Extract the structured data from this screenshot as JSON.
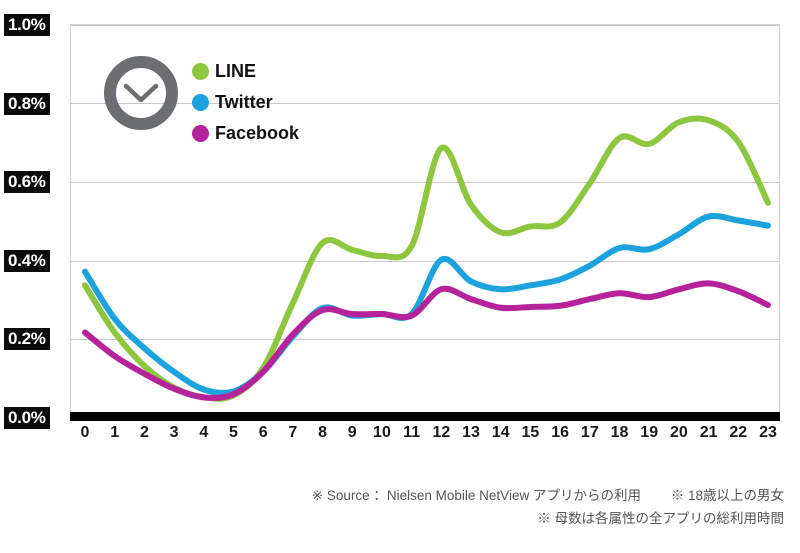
{
  "chart_data": {
    "type": "line",
    "title": "",
    "subtitle": "",
    "xlabel": "",
    "ylabel": "",
    "x": [
      0,
      1,
      2,
      3,
      4,
      5,
      6,
      7,
      8,
      9,
      10,
      11,
      12,
      13,
      14,
      15,
      16,
      17,
      18,
      19,
      20,
      21,
      22,
      23
    ],
    "xtick_labels": [
      "0",
      "1",
      "2",
      "3",
      "4",
      "5",
      "6",
      "7",
      "8",
      "9",
      "10",
      "11",
      "12",
      "13",
      "14",
      "15",
      "16",
      "17",
      "18",
      "19",
      "20",
      "21",
      "22",
      "23"
    ],
    "ytick_labels": [
      "0.0%",
      "0.2%",
      "0.4%",
      "0.6%",
      "0.8%",
      "1.0%"
    ],
    "ytick_values": [
      0.0,
      0.2,
      0.4,
      0.6,
      0.8,
      1.0
    ],
    "ylim": [
      0.0,
      1.0
    ],
    "xlim": [
      0,
      23
    ],
    "grid": true,
    "legend_position": "top-left-inside",
    "value_unit": "%",
    "series": [
      {
        "name": "LINE",
        "color": "#8DC63F",
        "values": [
          0.335,
          0.215,
          0.13,
          0.075,
          0.05,
          0.055,
          0.125,
          0.29,
          0.443,
          0.425,
          0.41,
          0.435,
          0.684,
          0.54,
          0.47,
          0.485,
          0.495,
          0.595,
          0.71,
          0.695,
          0.75,
          0.755,
          0.7,
          0.545
        ]
      },
      {
        "name": "Twitter",
        "color": "#1CA3DD",
        "values": [
          0.37,
          0.25,
          0.175,
          0.115,
          0.07,
          0.065,
          0.115,
          0.205,
          0.277,
          0.258,
          0.262,
          0.262,
          0.4,
          0.345,
          0.325,
          0.335,
          0.35,
          0.385,
          0.43,
          0.427,
          0.465,
          0.51,
          0.5,
          0.487
        ]
      },
      {
        "name": "Facebook",
        "color": "#B5229A",
        "values": [
          0.215,
          0.155,
          0.11,
          0.072,
          0.05,
          0.058,
          0.115,
          0.21,
          0.272,
          0.262,
          0.262,
          0.258,
          0.325,
          0.3,
          0.278,
          0.28,
          0.283,
          0.3,
          0.315,
          0.305,
          0.325,
          0.34,
          0.32,
          0.285
        ]
      }
    ]
  },
  "legend": {
    "items": [
      {
        "label": "LINE",
        "color": "#8DC63F"
      },
      {
        "label": "Twitter",
        "color": "#1CA3DD"
      },
      {
        "label": "Facebook",
        "color": "#B5229A"
      }
    ]
  },
  "icons": {
    "clock": "clock-icon",
    "clock_color": "#6D6E71"
  },
  "footnotes": {
    "line1_left": "※ Source ：Nielsen Mobile NetView  アプリからの利用",
    "line1_right": "※ 18歳以上の男女",
    "line2": "※ 母数は各属性の全アプリの総利用時間"
  }
}
